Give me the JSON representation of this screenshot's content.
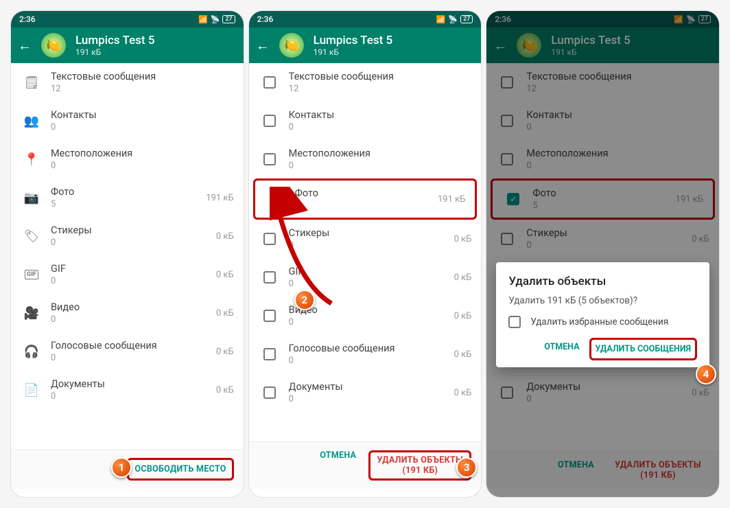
{
  "status": {
    "time": "2:36",
    "battery": "27"
  },
  "header": {
    "title": "Lumpics Test 5",
    "subtitle": "191 кБ"
  },
  "categories": [
    {
      "icon": "text-icon",
      "glyph": "🗒",
      "label": "Текстовые сообщения",
      "count": "12",
      "size": ""
    },
    {
      "icon": "contacts-icon",
      "glyph": "👥",
      "label": "Контакты",
      "count": "0",
      "size": ""
    },
    {
      "icon": "location-icon",
      "glyph": "📍",
      "label": "Местоположения",
      "count": "0",
      "size": ""
    },
    {
      "icon": "photo-icon",
      "glyph": "📷",
      "label": "Фото",
      "count": "5",
      "size": "191 кБ"
    },
    {
      "icon": "sticker-icon",
      "glyph": "🏷",
      "label": "Стикеры",
      "count": "0",
      "size": "0 кБ"
    },
    {
      "icon": "gif-icon",
      "glyph": "GIF",
      "label": "GIF",
      "count": "0",
      "size": "0 кБ"
    },
    {
      "icon": "video-icon",
      "glyph": "🎥",
      "label": "Видео",
      "count": "0",
      "size": "0 кБ"
    },
    {
      "icon": "audio-icon",
      "glyph": "🎧",
      "label": "Голосовые сообщения",
      "count": "0",
      "size": "0 кБ"
    },
    {
      "icon": "doc-icon",
      "glyph": "📄",
      "label": "Документы",
      "count": "0",
      "size": "0 кБ"
    }
  ],
  "footer1": {
    "primary": "ОСВОБОДИТЬ МЕСТО"
  },
  "footer2": {
    "cancel": "ОТМЕНА",
    "delete": "УДАЛИТЬ ОБЪЕКТЫ (191 КБ)"
  },
  "dialog": {
    "title": "Удалить объекты",
    "message": "Удалить 191 кБ (5 объектов)?",
    "option": "Удалить избранные сообщения",
    "cancel": "ОТМЕНА",
    "confirm": "УДАЛИТЬ СООБЩЕНИЯ"
  },
  "badges": {
    "b1": "1",
    "b2": "2",
    "b3": "3",
    "b4": "4"
  }
}
